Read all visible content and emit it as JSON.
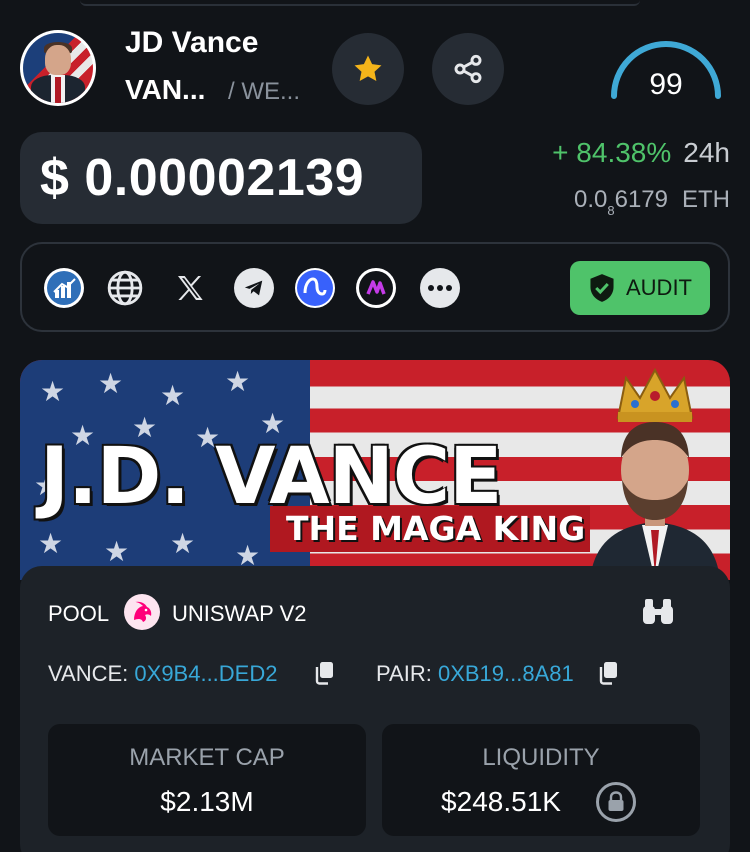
{
  "header": {
    "token_name": "JD Vance",
    "token_symbol": "VAN...",
    "chain": "/ WE...",
    "score": "99"
  },
  "price": {
    "usd": "$ 0.00002139",
    "change_pct": "+ 84.38%",
    "change_period": "24h",
    "eth_prefix": "0.0",
    "eth_zero_count": "8",
    "eth_digits": "6179",
    "eth_unit": "ETH"
  },
  "links": {
    "items": [
      "chart-icon",
      "globe-icon",
      "x-icon",
      "telegram-icon",
      "coinmarketcap-icon",
      "analytics-icon",
      "more-icon"
    ],
    "audit_label": "AUDIT"
  },
  "banner": {
    "title": "J.D. VANCE",
    "subtitle": "THE MAGA KING"
  },
  "pool": {
    "label": "POOL",
    "dex": "UNISWAP V2",
    "token_label": "VANCE:",
    "token_address": "0X9B4...DED2",
    "pair_label": "PAIR:",
    "pair_address": "0XB19...8A81",
    "market_cap_label": "MARKET CAP",
    "market_cap_value": "$2.13M",
    "liquidity_label": "LIQUIDITY",
    "liquidity_value": "$248.51K"
  },
  "colors": {
    "background": "#111418",
    "surface": "#262c34",
    "positive": "#4fc36a",
    "link": "#38a8d8",
    "score_arc": "#3fa9d6"
  }
}
